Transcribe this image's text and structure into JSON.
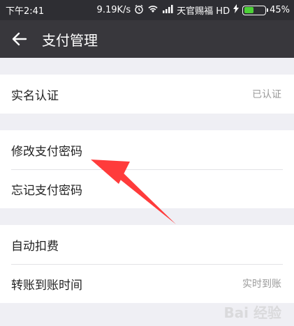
{
  "status_bar": {
    "time": "下午2:41",
    "network_speed": "9.19K/s",
    "carrier": "天官赐福 HD",
    "battery": "45%",
    "battery_level": 0.45,
    "icons": [
      "alarm-icon",
      "wifi-icon",
      "signal-icon",
      "charging-icon",
      "battery-icon"
    ]
  },
  "nav": {
    "title": "支付管理",
    "back_icon": "arrow-left-icon"
  },
  "groups": [
    {
      "items": [
        {
          "label": "实名认证",
          "value": "已认证"
        }
      ]
    },
    {
      "items": [
        {
          "label": "修改支付密码",
          "value": ""
        },
        {
          "label": "忘记支付密码",
          "value": ""
        }
      ]
    },
    {
      "items": [
        {
          "label": "自动扣费",
          "value": ""
        },
        {
          "label": "转账到账时间",
          "value": "实时到账"
        }
      ]
    }
  ],
  "annotation": {
    "arrow_color": "#ff3b3b",
    "arrow_icon": "red-arrow-annotation"
  },
  "watermark": "Bai 经验",
  "colors": {
    "nav_bg": "#38373c",
    "status_bg": "#2e2e33",
    "page_bg": "#efeff4",
    "row_bg": "#ffffff",
    "secondary_text": "#9a9a9a",
    "battery_fill": "#4cd137"
  }
}
